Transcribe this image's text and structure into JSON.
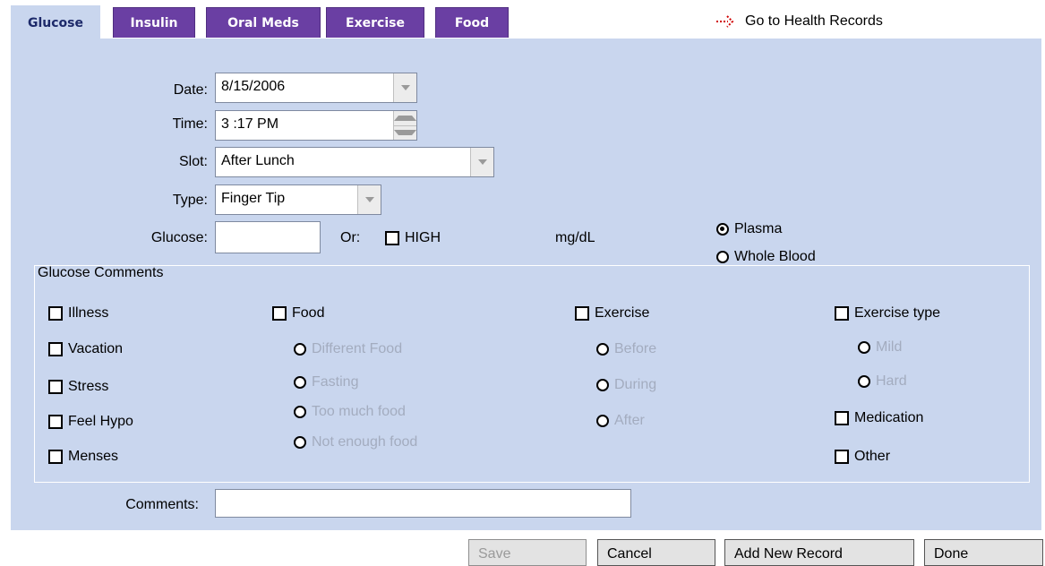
{
  "tabs": [
    {
      "label": "Glucose",
      "active": true
    },
    {
      "label": "Insulin",
      "active": false
    },
    {
      "label": "Oral Meds",
      "active": false
    },
    {
      "label": "Exercise",
      "active": false
    },
    {
      "label": "Food",
      "active": false
    }
  ],
  "health_link": {
    "icon": "dotted-arrow-icon",
    "label": "Go to Health Records",
    "color": "#d00000"
  },
  "form": {
    "date": {
      "label": "Date:",
      "value": "8/15/2006"
    },
    "time": {
      "label": "Time:",
      "value": "3 :17 PM"
    },
    "slot": {
      "label": "Slot:",
      "value": "After Lunch"
    },
    "type": {
      "label": "Type:",
      "value": "Finger Tip"
    },
    "glucose": {
      "label": "Glucose:",
      "value": "",
      "or_label": "Or:",
      "high_label": "HIGH",
      "high_checked": false,
      "unit": "mg/dL"
    },
    "sample": {
      "plasma_label": "Plasma",
      "plasma_selected": true,
      "whole_blood_label": "Whole Blood",
      "whole_blood_selected": false
    }
  },
  "glucose_comments": {
    "heading": "Glucose Comments",
    "col1": [
      "Illness",
      "Vacation",
      "Stress",
      "Feel Hypo",
      "Menses"
    ],
    "food": {
      "label": "Food",
      "options": [
        "Different Food",
        "Fasting",
        "Too much food",
        "Not enough food"
      ]
    },
    "exercise": {
      "label": "Exercise",
      "options": [
        "Before",
        "During",
        "After"
      ]
    },
    "exercise_type": {
      "label": "Exercise type",
      "options": [
        "Mild",
        "Hard"
      ]
    },
    "medication": "Medication",
    "other": "Other"
  },
  "comments": {
    "label": "Comments:",
    "value": ""
  },
  "buttons": {
    "save": "Save",
    "cancel": "Cancel",
    "add_new": "Add New Record",
    "done": "Done"
  },
  "colors": {
    "panel": "#c9d6ee",
    "tab": "#6a3fa3",
    "active_tab_text": "#1d2a6a",
    "disabled_text": "#a3acbf"
  }
}
